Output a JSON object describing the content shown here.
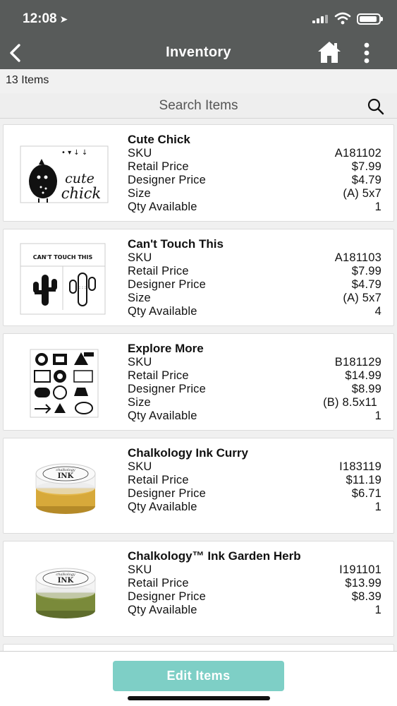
{
  "status_bar": {
    "time": "12:08",
    "location_arrow": "location-arrow-icon"
  },
  "nav": {
    "title": "Inventory",
    "back_icon": "chevron-left-icon",
    "home_icon": "home-icon",
    "more_icon": "more-vertical-icon"
  },
  "summary": {
    "item_count": "13 Items"
  },
  "search": {
    "placeholder": "Search Items",
    "icon": "search-icon"
  },
  "labels": {
    "sku": "SKU",
    "retail": "Retail Price",
    "designer": "Designer Price",
    "size": "Size",
    "qty": "Qty Available"
  },
  "items": [
    {
      "title": "Cute Chick",
      "sku": "A181102",
      "retail": "$7.99",
      "designer": "$4.79",
      "size": "(A) 5x7",
      "qty": "1",
      "thumb_text": [
        "cute",
        "chick"
      ]
    },
    {
      "title": "Can't Touch This",
      "sku": "A181103",
      "retail": "$7.99",
      "designer": "$4.79",
      "size": "(A) 5x7",
      "qty": "4",
      "thumb_text": [
        "CAN'T TOUCH THIS"
      ]
    },
    {
      "title": "Explore More",
      "sku": "B181129",
      "retail": "$14.99",
      "designer": "$8.99",
      "size": "(B) 8.5x11",
      "qty": "1"
    },
    {
      "title": "Chalkology Ink Curry",
      "sku": "I183119",
      "retail": "$11.19",
      "designer": "$6.71",
      "qty": "1",
      "thumb_text": [
        "INK"
      ]
    },
    {
      "title": "Chalkology™ Ink Garden Herb",
      "sku": "I191101",
      "retail": "$13.99",
      "designer": "$8.39",
      "qty": "1",
      "thumb_text": [
        "INK"
      ]
    }
  ],
  "footer": {
    "edit_label": "Edit Items"
  },
  "colors": {
    "header": "#585b5a",
    "accent": "#7ecfc6",
    "curry": "#d7a93a",
    "herb": "#7a8a3a"
  }
}
